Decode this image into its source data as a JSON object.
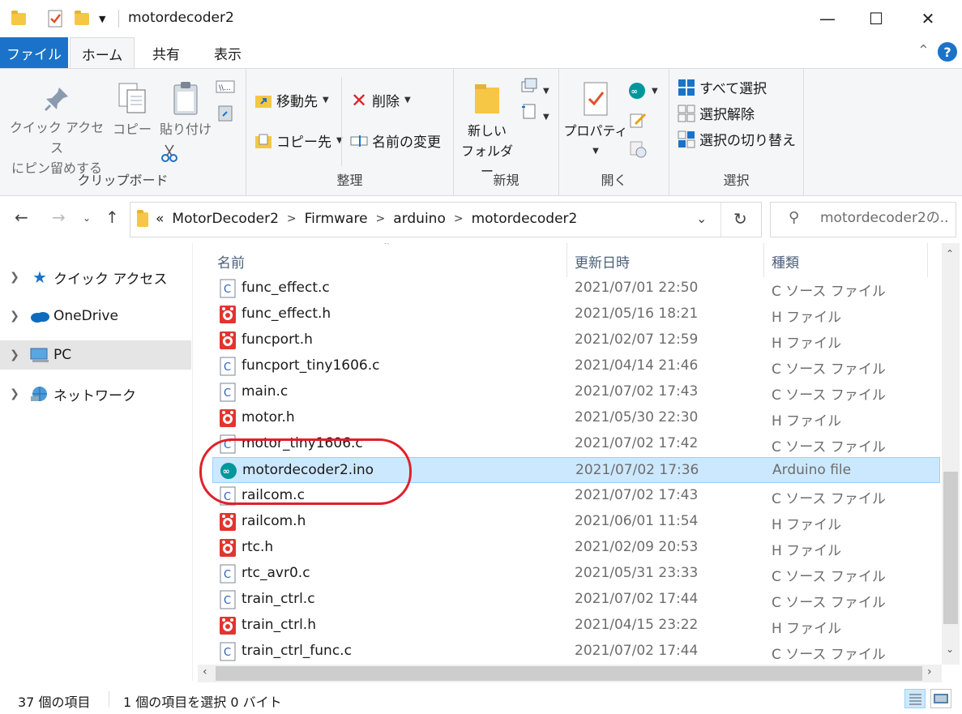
{
  "window": {
    "title": "motordecoder2",
    "minimize": "—",
    "maximize": "☐",
    "close": "✕"
  },
  "ribbon_tabs": {
    "file": "ファイル",
    "home": "ホーム",
    "share": "共有",
    "view": "表示"
  },
  "ribbon": {
    "clipboard": {
      "label": "クリップボード",
      "pin_line1": "クイック アクセス",
      "pin_line2": "にピン留めする",
      "copy": "コピー",
      "paste": "貼り付け"
    },
    "organize": {
      "label": "整理",
      "move_to": "移動先",
      "copy_to": "コピー先",
      "delete": "削除",
      "rename": "名前の変更"
    },
    "new": {
      "label": "新規",
      "new_folder_line1": "新しい",
      "new_folder_line2": "フォルダー"
    },
    "open": {
      "label": "開く",
      "properties": "プロパティ"
    },
    "select": {
      "label": "選択",
      "select_all": "すべて選択",
      "select_none": "選択解除",
      "invert": "選択の切り替え"
    }
  },
  "address": {
    "overflow": "«",
    "crumbs": [
      "MotorDecoder2",
      "Firmware",
      "arduino",
      "motordecoder2"
    ],
    "search_placeholder": "motordecoder2の..."
  },
  "nav": {
    "items": [
      {
        "label": "クイック アクセス"
      },
      {
        "label": "OneDrive"
      },
      {
        "label": "PC"
      },
      {
        "label": "ネットワーク"
      }
    ]
  },
  "columns": {
    "name": "名前",
    "date": "更新日時",
    "type": "種類"
  },
  "files": [
    {
      "name": "func_effect.c",
      "date": "2021/07/01 22:50",
      "type": "C ソース ファイル",
      "icon": "c-file-icon"
    },
    {
      "name": "func_effect.h",
      "date": "2021/05/16 18:21",
      "type": "H ファイル",
      "icon": "h-file-icon"
    },
    {
      "name": "funcport.h",
      "date": "2021/02/07 12:59",
      "type": "H ファイル",
      "icon": "h-file-icon"
    },
    {
      "name": "funcport_tiny1606.c",
      "date": "2021/04/14 21:46",
      "type": "C ソース ファイル",
      "icon": "c-file-icon"
    },
    {
      "name": "main.c",
      "date": "2021/07/02 17:43",
      "type": "C ソース ファイル",
      "icon": "c-file-icon"
    },
    {
      "name": "motor.h",
      "date": "2021/05/30 22:30",
      "type": "H ファイル",
      "icon": "h-file-icon"
    },
    {
      "name": "motor_tiny1606.c",
      "date": "2021/07/02 17:42",
      "type": "C ソース ファイル",
      "icon": "c-file-icon"
    },
    {
      "name": "motordecoder2.ino",
      "date": "2021/07/02 17:36",
      "type": "Arduino file",
      "icon": "arduino-file-icon",
      "selected": true
    },
    {
      "name": "railcom.c",
      "date": "2021/07/02 17:43",
      "type": "C ソース ファイル",
      "icon": "c-file-icon"
    },
    {
      "name": "railcom.h",
      "date": "2021/06/01 11:54",
      "type": "H ファイル",
      "icon": "h-file-icon"
    },
    {
      "name": "rtc.h",
      "date": "2021/02/09 20:53",
      "type": "H ファイル",
      "icon": "h-file-icon"
    },
    {
      "name": "rtc_avr0.c",
      "date": "2021/05/31 23:33",
      "type": "C ソース ファイル",
      "icon": "c-file-icon"
    },
    {
      "name": "train_ctrl.c",
      "date": "2021/07/02 17:44",
      "type": "C ソース ファイル",
      "icon": "c-file-icon"
    },
    {
      "name": "train_ctrl.h",
      "date": "2021/04/15 23:22",
      "type": "H ファイル",
      "icon": "h-file-icon"
    },
    {
      "name": "train_ctrl_func.c",
      "date": "2021/07/02 17:44",
      "type": "C ソース ファイル",
      "icon": "c-file-icon"
    }
  ],
  "status": {
    "count": "37 個の項目",
    "selection": "1 個の項目を選択  0 バイト"
  },
  "colors": {
    "accent": "#1a73c8",
    "selection": "#cce8ff",
    "annotation": "#e0202a"
  }
}
